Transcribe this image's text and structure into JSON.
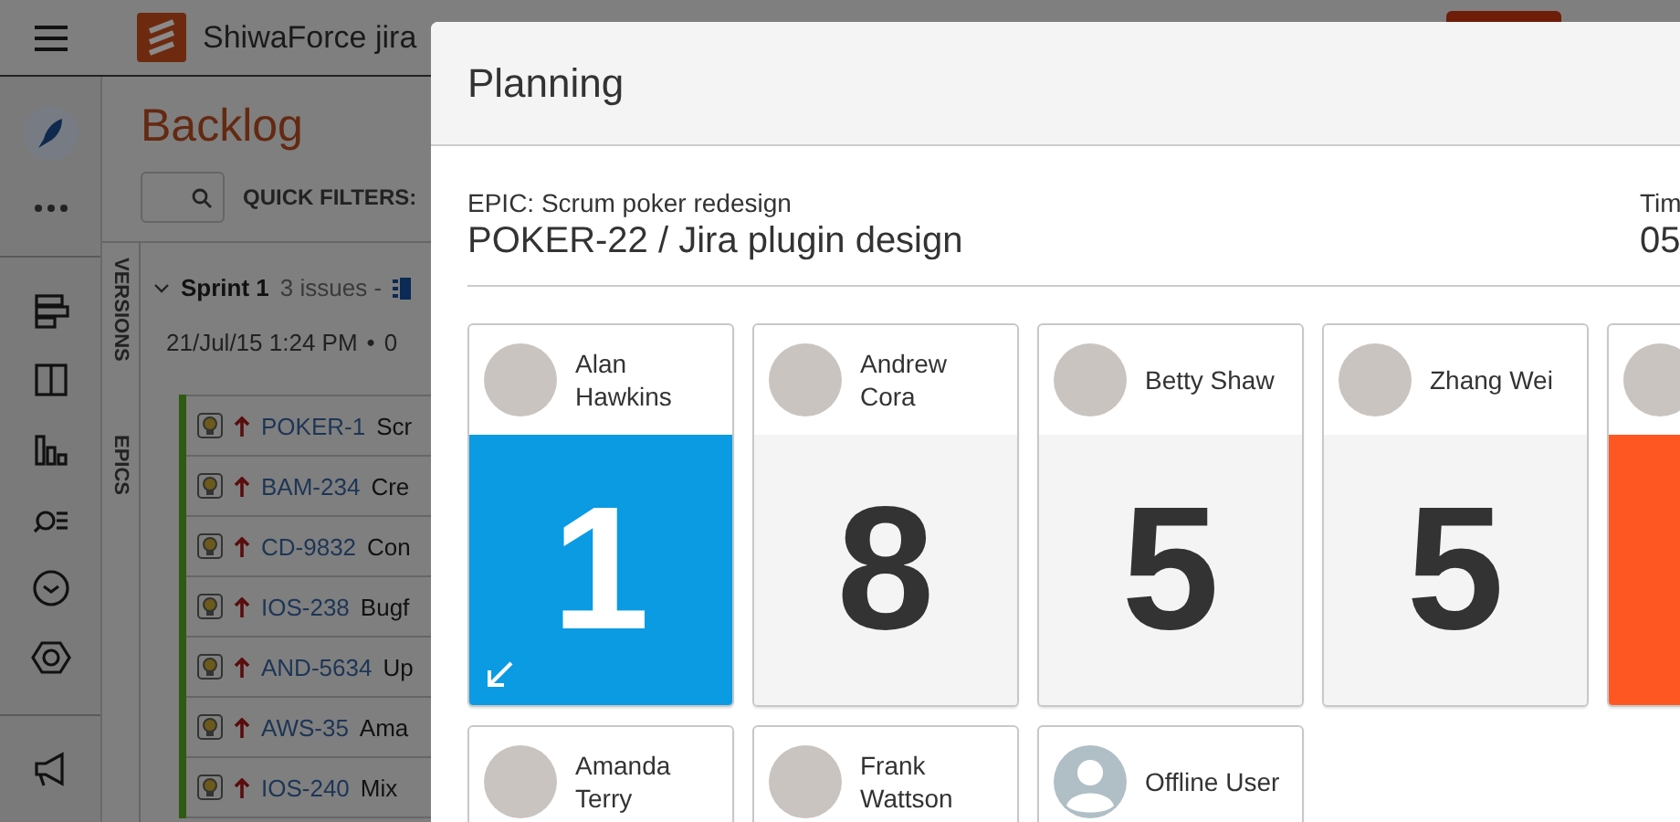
{
  "app": {
    "title": "ShiwaForce jira"
  },
  "backlog": {
    "title": "Backlog",
    "quick_filters": "QUICK FILTERS:",
    "side_tabs": [
      "VERSIONS",
      "EPICS"
    ],
    "sprint": {
      "name": "Sprint 1",
      "expanded": true,
      "issues": "3 issues -",
      "dates": "21/Jul/15 1:24 PM",
      "dates_separator": "•",
      "dates_tail": "0"
    },
    "issues": [
      {
        "key": "POKER-1",
        "summary": "Scr"
      },
      {
        "key": "BAM-234",
        "summary": "Cre"
      },
      {
        "key": "CD-9832",
        "summary": "Con"
      },
      {
        "key": "IOS-238",
        "summary": "Bugf"
      },
      {
        "key": "AND-5634",
        "summary": "Up"
      },
      {
        "key": "AWS-35",
        "summary": "Ama"
      },
      {
        "key": "IOS-240",
        "summary": "Mix"
      }
    ]
  },
  "modal": {
    "title": "Planning",
    "epic": "EPIC: Scrum poker redesign",
    "issue": "POKER-22 / Jira plugin design",
    "timer_label": "Tim",
    "timer_value": "05",
    "votes": [
      {
        "name": "Alan Hawkins",
        "vote": "1",
        "selected": true,
        "color": "#0a9be3"
      },
      {
        "name": "Andrew Cora",
        "vote": "8",
        "selected": false,
        "color": "#f4f4f4"
      },
      {
        "name": "Betty Shaw",
        "vote": "5",
        "selected": false,
        "color": "#f4f4f4"
      },
      {
        "name": "Zhang Wei",
        "vote": "5",
        "selected": false,
        "color": "#f4f4f4"
      },
      {
        "selected": false,
        "color": "#ff5722"
      }
    ],
    "waiting": [
      {
        "name": "Amanda Terry",
        "kind": "user"
      },
      {
        "name": "Frank Wattson",
        "kind": "user"
      },
      {
        "name": "Offline User",
        "kind": "offline"
      }
    ]
  }
}
